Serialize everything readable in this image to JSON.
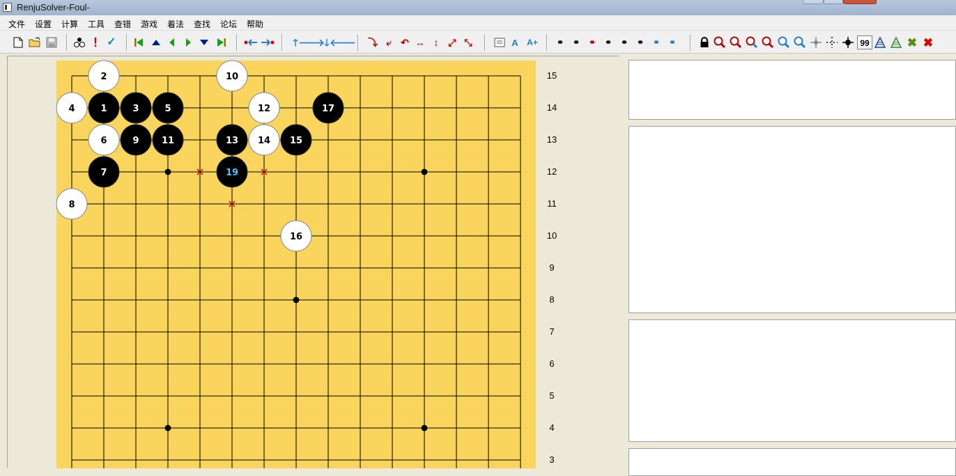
{
  "window": {
    "title": "RenjuSolver-Foul-"
  },
  "menu": [
    {
      "label": "文件"
    },
    {
      "label": "设置"
    },
    {
      "label": "计算"
    },
    {
      "label": "工具"
    },
    {
      "label": "查错"
    },
    {
      "label": "游戏"
    },
    {
      "label": "着法"
    },
    {
      "label": "查找"
    },
    {
      "label": "论坛"
    },
    {
      "label": "帮助"
    }
  ],
  "toolbar": {
    "depth_value": "99",
    "text_labels": {
      "a": "A",
      "a_plus": "A+"
    },
    "icons": [
      "new-file-icon",
      "open-folder-icon",
      "save-icon",
      "player-stones-icon",
      "exclaim-icon",
      "check-icon",
      "first-move-icon",
      "prev-block-icon",
      "prev-move-icon",
      "next-move-icon",
      "next-block-icon",
      "last-move-icon",
      "swap-left-icon",
      "swap-right-icon",
      "shift-up-icon",
      "shift-right-icon",
      "shift-down-icon",
      "shift-left-icon",
      "rotate-cw-icon",
      "rotate-ccw-icon",
      "undo-arc-icon",
      "flip-horizontal-icon",
      "flip-vertical-icon",
      "flip-diagonal-icon",
      "flip-antidiagonal-icon",
      "note-icon",
      "font-a-icon",
      "font-a-plus-icon",
      "search-1-icon",
      "search-2-icon",
      "search-3-icon",
      "search-4-icon",
      "search-5-icon",
      "search-6-icon",
      "search-7-icon",
      "search-8-icon",
      "lock-icon",
      "zoom-red-1-icon",
      "zoom-red-2-icon",
      "zoom-red-3-icon",
      "zoom-red-4-icon",
      "zoom-blue-1-icon",
      "zoom-blue-2-icon",
      "crosshair-icon",
      "dotted-cross-icon",
      "star-point-icon",
      "tree-blue-icon",
      "tree-green-icon",
      "cancel-green-icon",
      "close-red-icon"
    ]
  },
  "board": {
    "colors": {
      "board": "#F9D55E",
      "line": "#000000",
      "black_stone": "#000000",
      "white_stone": "#FFFFFF",
      "last_move_text": "#4FC3F7",
      "foul_mark": "#E00000"
    },
    "row_labels": [
      "15",
      "14",
      "13",
      "12",
      "11",
      "10",
      "9",
      "8",
      "7",
      "6",
      "5",
      "4",
      "3"
    ],
    "stars": [
      {
        "col": 3,
        "row": 4
      },
      {
        "col": 11,
        "row": 4
      },
      {
        "col": 7,
        "row": 8
      },
      {
        "col": 3,
        "row": 12
      },
      {
        "col": 11,
        "row": 12
      }
    ],
    "stones": [
      {
        "n": "1",
        "color": "black",
        "col": 1,
        "row": 14
      },
      {
        "n": "2",
        "color": "white",
        "col": 1,
        "row": 15
      },
      {
        "n": "3",
        "color": "black",
        "col": 2,
        "row": 14
      },
      {
        "n": "4",
        "color": "white",
        "col": 0,
        "row": 14
      },
      {
        "n": "5",
        "color": "black",
        "col": 3,
        "row": 14
      },
      {
        "n": "6",
        "color": "white",
        "col": 1,
        "row": 13
      },
      {
        "n": "7",
        "color": "black",
        "col": 1,
        "row": 12
      },
      {
        "n": "8",
        "color": "white",
        "col": 0,
        "row": 11
      },
      {
        "n": "9",
        "color": "black",
        "col": 2,
        "row": 13
      },
      {
        "n": "10",
        "color": "white",
        "col": 5,
        "row": 15
      },
      {
        "n": "11",
        "color": "black",
        "col": 3,
        "row": 13
      },
      {
        "n": "12",
        "color": "white",
        "col": 6,
        "row": 14
      },
      {
        "n": "13",
        "color": "black",
        "col": 5,
        "row": 13
      },
      {
        "n": "14",
        "color": "white",
        "col": 6,
        "row": 13
      },
      {
        "n": "15",
        "color": "black",
        "col": 7,
        "row": 13
      },
      {
        "n": "16",
        "color": "white",
        "col": 7,
        "row": 10
      },
      {
        "n": "17",
        "color": "black",
        "col": 8,
        "row": 14
      },
      {
        "n": "19",
        "color": "black",
        "col": 5,
        "row": 12,
        "last": true
      }
    ],
    "foul_marks": [
      {
        "col": 4,
        "row": 12
      },
      {
        "col": 6,
        "row": 12
      },
      {
        "col": 5,
        "row": 11
      }
    ]
  }
}
